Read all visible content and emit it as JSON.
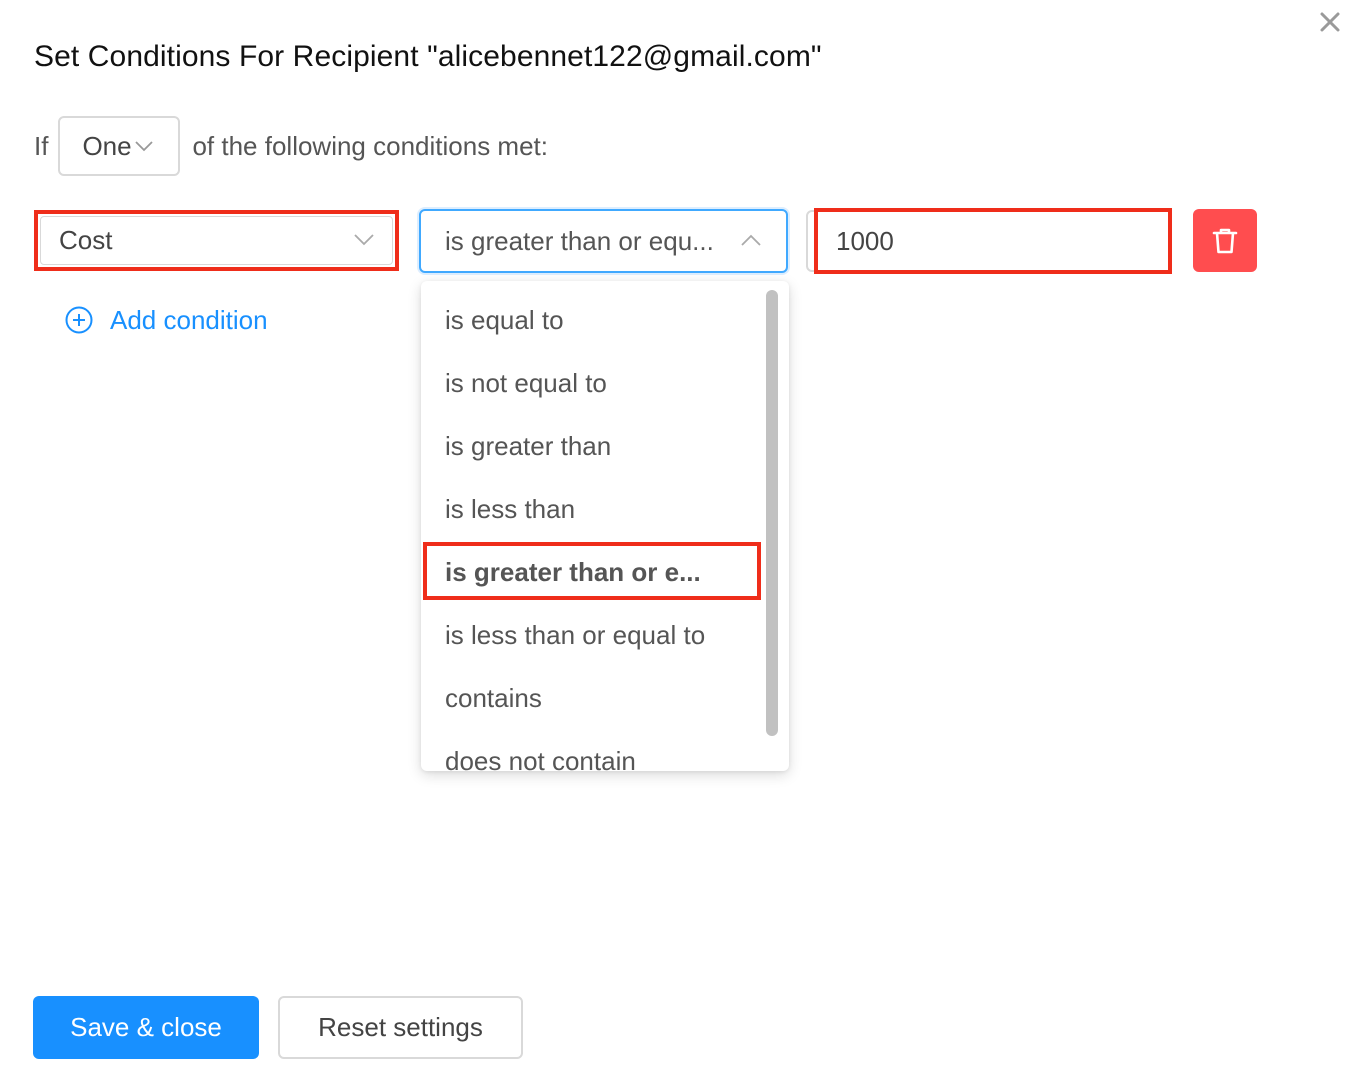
{
  "dialog": {
    "title": "Set Conditions For Recipient \"alicebennet122@gmail.com\"",
    "close_icon": "close-icon"
  },
  "match": {
    "prefix": "If",
    "value": "One",
    "suffix": "of the following conditions met:"
  },
  "condition": {
    "field": "Cost",
    "operator": "is greater than or equ...",
    "value": "1000",
    "delete_icon": "trash-icon"
  },
  "add_condition": {
    "label": "Add condition",
    "icon": "plus-circle-icon"
  },
  "operator_dropdown": {
    "options": [
      {
        "label": "is equal to"
      },
      {
        "label": "is not equal to"
      },
      {
        "label": "is greater than"
      },
      {
        "label": "is less than"
      },
      {
        "label": "is greater than or e...",
        "selected": true
      },
      {
        "label": "is less than or equal to"
      },
      {
        "label": "contains"
      },
      {
        "label": "does not contain"
      }
    ]
  },
  "footer": {
    "save_label": "Save & close",
    "reset_label": "Reset settings"
  },
  "colors": {
    "primary": "#1890ff",
    "danger": "#ff4d4f",
    "highlight": "#ef2d1a"
  }
}
